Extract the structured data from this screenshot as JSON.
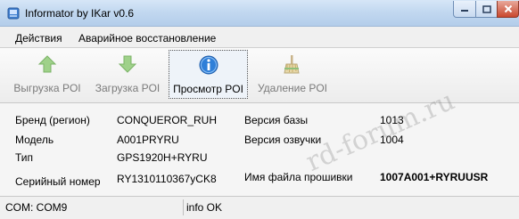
{
  "window": {
    "title": "Informator by IKar v0.6"
  },
  "menu": {
    "items": [
      "Действия",
      "Аварийное восстановление"
    ]
  },
  "toolbar": {
    "buttons": [
      {
        "label": "Выгрузка POI",
        "icon": "arrow-up-green-icon",
        "enabled": false
      },
      {
        "label": "Загрузка POI",
        "icon": "arrow-down-green-icon",
        "enabled": false
      },
      {
        "label": "Просмотр POI",
        "icon": "info-icon",
        "enabled": true,
        "selected": true
      },
      {
        "label": "Удаление POI",
        "icon": "broom-icon",
        "enabled": false
      }
    ]
  },
  "info": {
    "left": [
      {
        "label": "Бренд (регион)",
        "value": "CONQUEROR_RUH"
      },
      {
        "label": "Модель",
        "value": "A001PRYRU"
      },
      {
        "label": "Тип",
        "value": "GPS1920H+RYRU"
      },
      {
        "label": "Серийный номер",
        "value": "RY1310110367yCK8"
      }
    ],
    "right": [
      {
        "label": "Версия базы",
        "value": "1013"
      },
      {
        "label": "Версия озвучки",
        "value": "1004"
      },
      {
        "label": "Имя файла прошивки",
        "value": "1007A001+RYRUUSR"
      }
    ]
  },
  "watermark": "rd-forum.ru",
  "status": {
    "port": "COM: COM9",
    "info": "info OK"
  },
  "colors": {
    "title_bar": "#c2d8f0",
    "close_button": "#c9472d",
    "panel": "#f5f5f5"
  }
}
